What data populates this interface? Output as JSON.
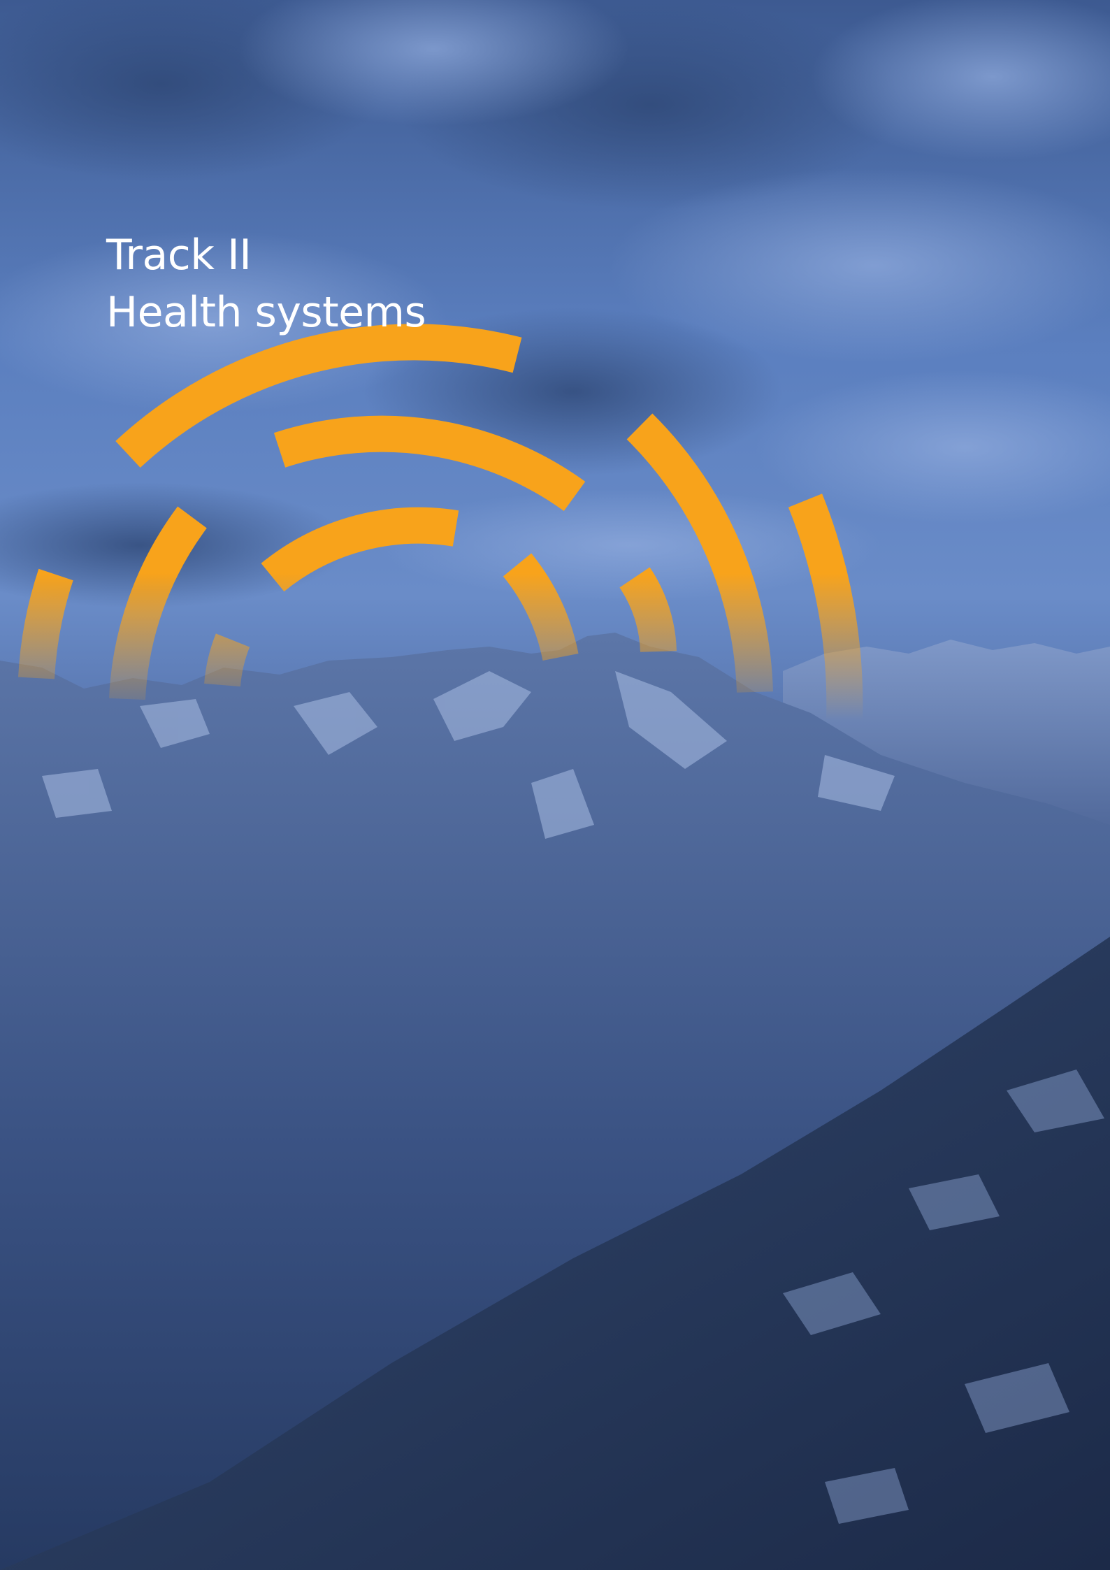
{
  "cover": {
    "track_label": "Track II",
    "track_title": "Health systems"
  },
  "colors": {
    "overlay_blue": "#5b7fbf",
    "deep_navy": "#1f2f52",
    "accent_orange": "#f8a31b",
    "text_white": "#ffffff"
  },
  "icons": {
    "signal_arcs": "concentric-broadcast-arcs"
  }
}
